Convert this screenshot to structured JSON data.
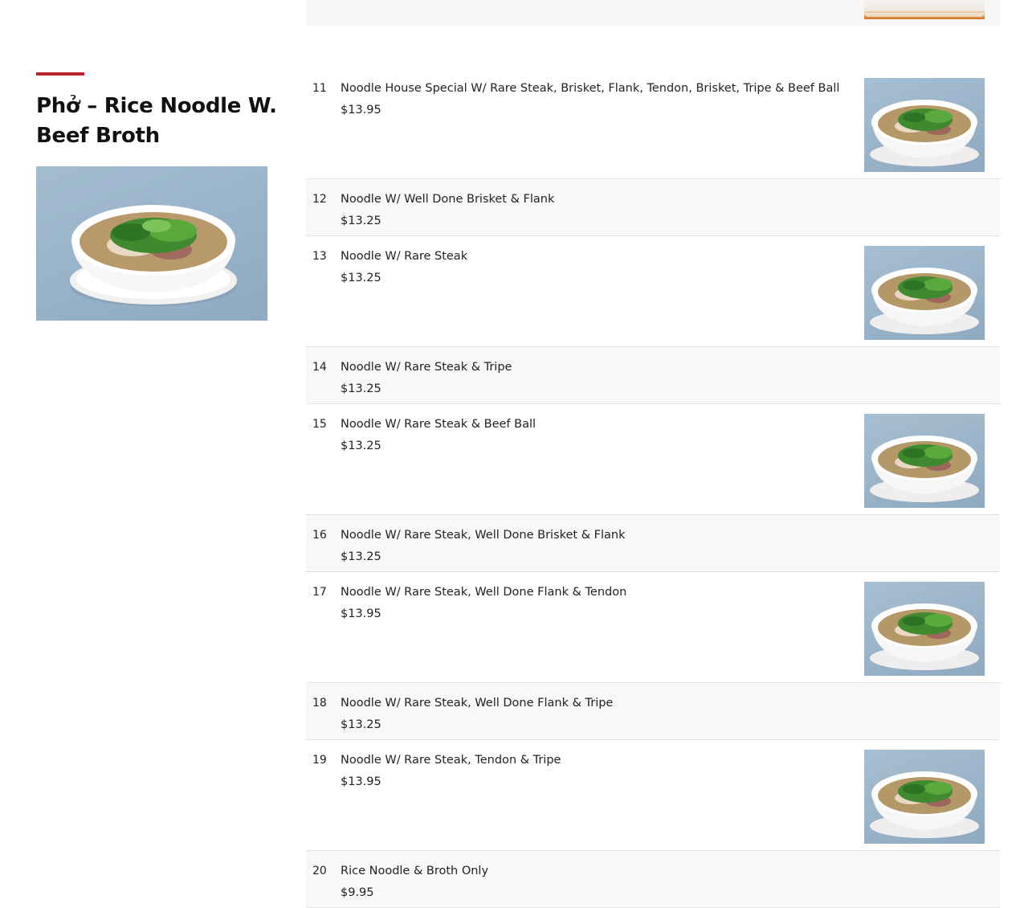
{
  "section": {
    "title": "Phở – Rice Noodle W. Beef Broth",
    "photo_icon": "pho-bowl-photo"
  },
  "menu": {
    "items": [
      {
        "num": "11",
        "name": "Noodle House Special W/ Rare Steak, Brisket, Flank, Tendon, Brisket, Tripe & Beef Ball",
        "price": "$13.95",
        "has_image": true
      },
      {
        "num": "12",
        "name": "Noodle W/ Well Done Brisket & Flank",
        "price": "$13.25",
        "has_image": false
      },
      {
        "num": "13",
        "name": "Noodle W/ Rare Steak",
        "price": "$13.25",
        "has_image": true
      },
      {
        "num": "14",
        "name": "Noodle W/ Rare Steak & Tripe",
        "price": "$13.25",
        "has_image": false
      },
      {
        "num": "15",
        "name": "Noodle W/ Rare Steak & Beef Ball",
        "price": "$13.25",
        "has_image": true
      },
      {
        "num": "16",
        "name": "Noodle W/ Rare Steak, Well Done Brisket & Flank",
        "price": "$13.25",
        "has_image": false
      },
      {
        "num": "17",
        "name": "Noodle W/ Rare Steak, Well Done Flank & Tendon",
        "price": "$13.95",
        "has_image": true
      },
      {
        "num": "18",
        "name": "Noodle W/ Rare Steak, Well Done Flank & Tripe",
        "price": "$13.25",
        "has_image": false
      },
      {
        "num": "19",
        "name": "Noodle W/ Rare Steak, Tendon & Tripe",
        "price": "$13.95",
        "has_image": true
      },
      {
        "num": "20",
        "name": "Rice Noodle & Broth Only",
        "price": "$9.95",
        "has_image": false
      }
    ]
  },
  "colors": {
    "accent": "#b8252f",
    "row_alt": "#f8f8f8",
    "divider": "#e2e2e2"
  }
}
